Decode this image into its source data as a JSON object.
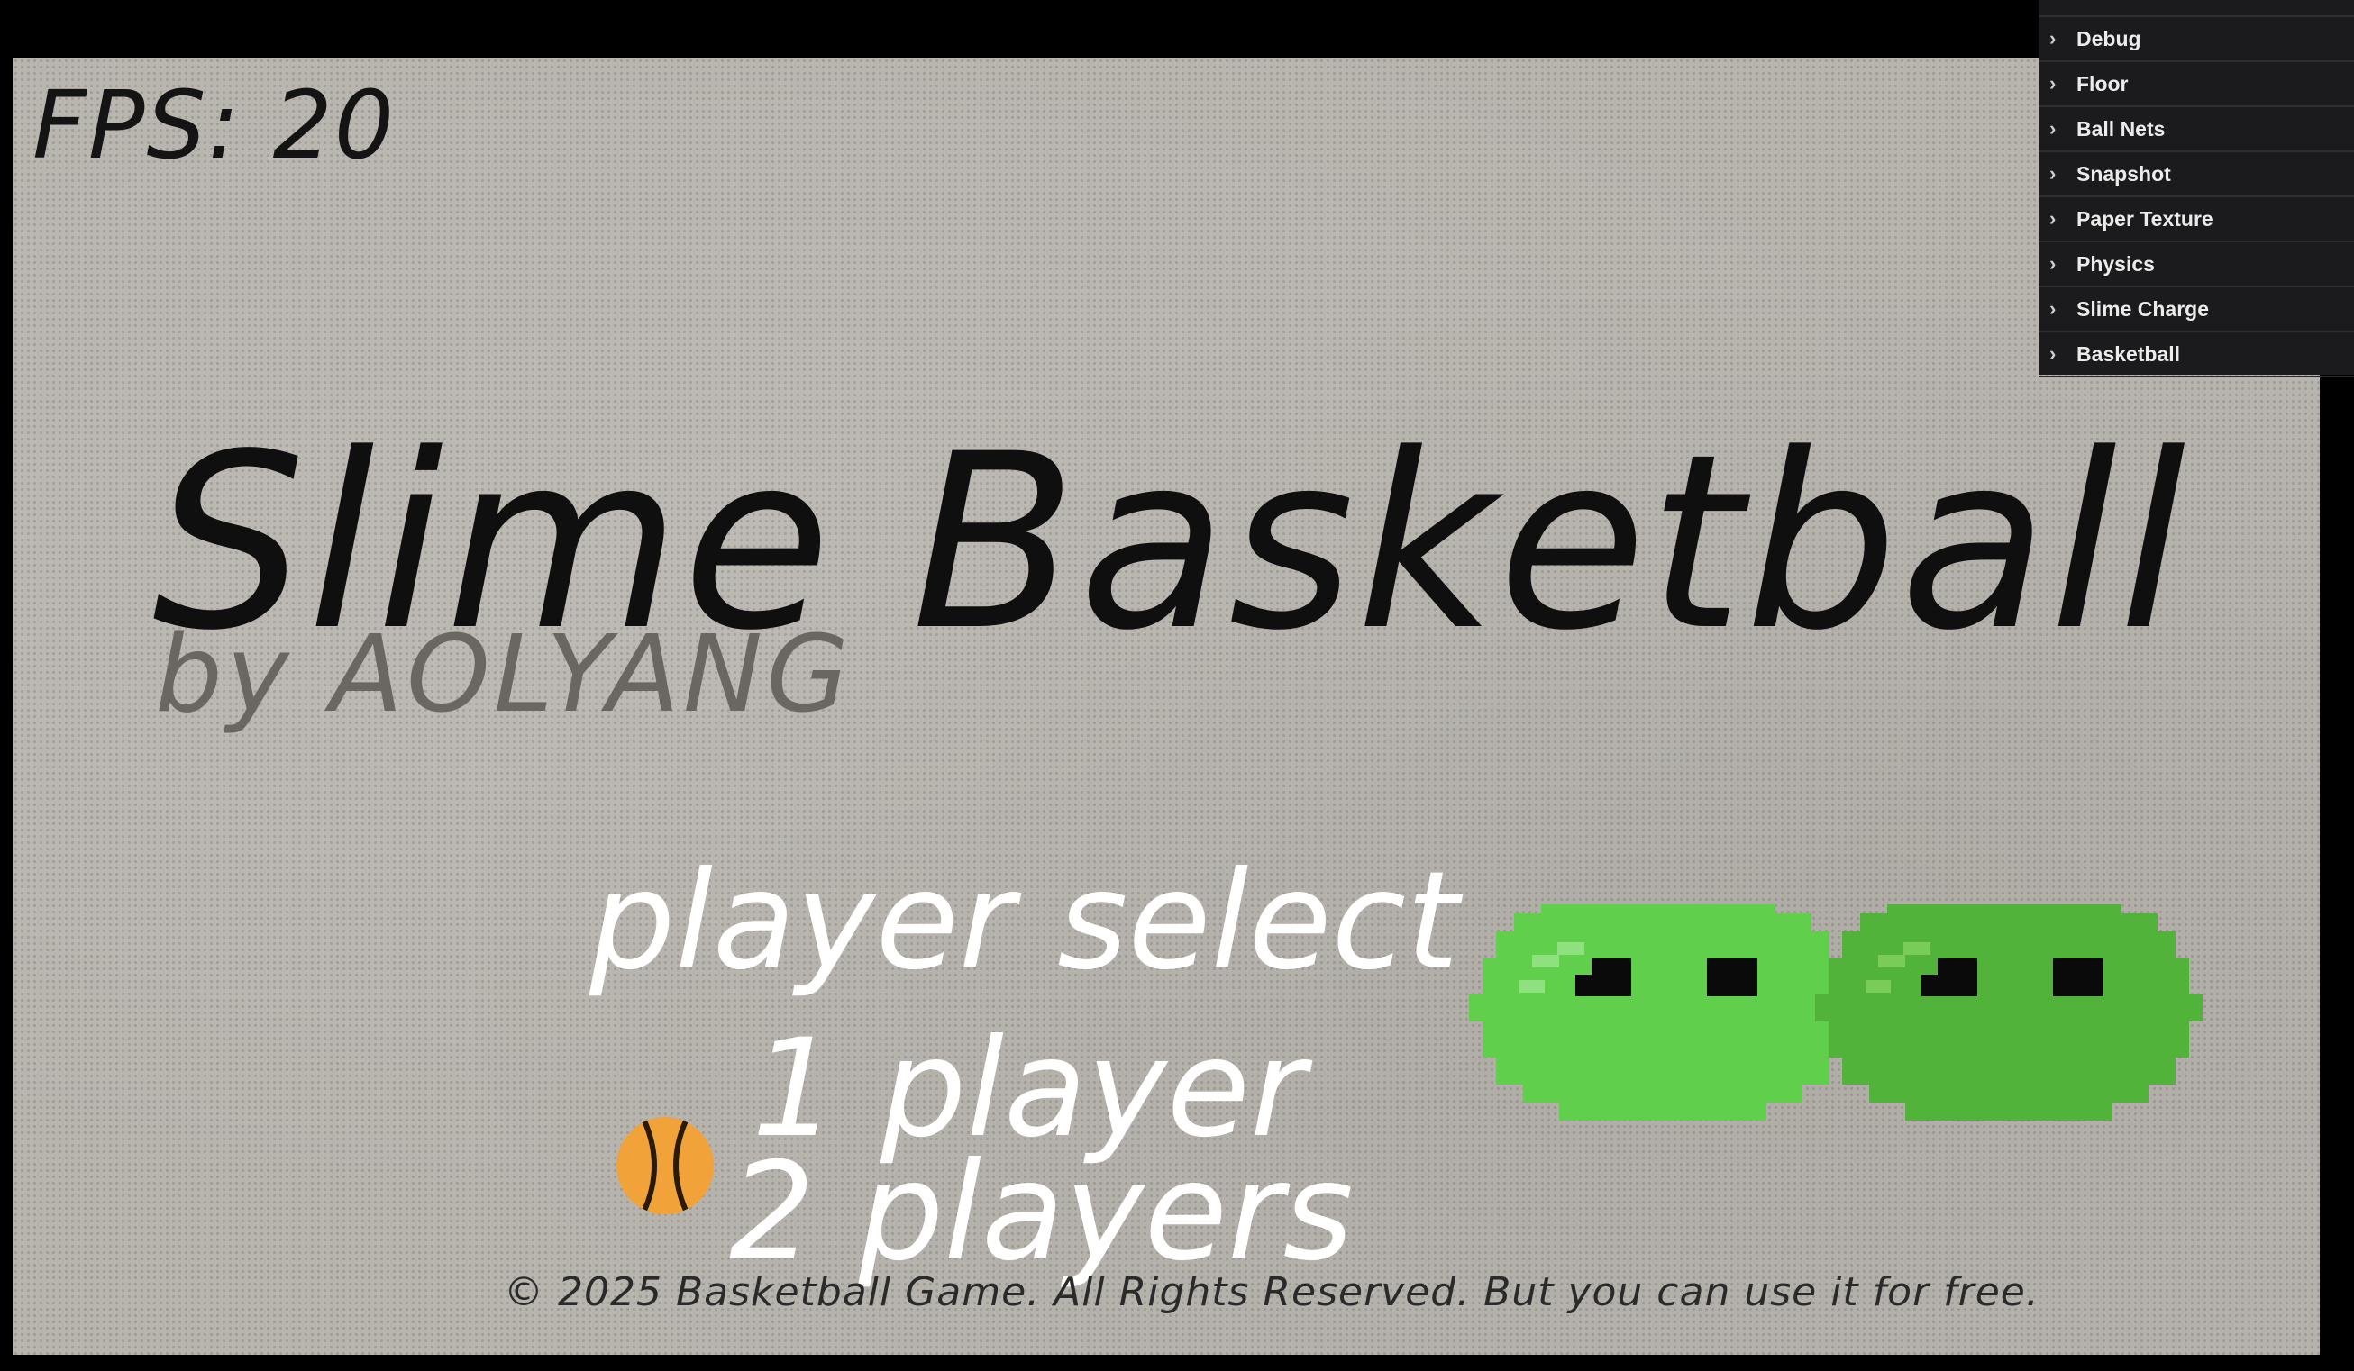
{
  "hud": {
    "fps_text": "FPS: 20"
  },
  "title": {
    "main": "Slime Basketball",
    "byline": "by AOLYANG"
  },
  "menu": {
    "heading": "player select",
    "items": [
      {
        "label": "1 player",
        "selected": false
      },
      {
        "label": "2 players",
        "selected": true
      }
    ],
    "cursor_icon": "basketball-icon"
  },
  "footer": {
    "text": "© 2025 Basketball Game. All Rights Reserved. But you can use it for free."
  },
  "slimes": [
    {
      "name": "left-slime",
      "color": "#5fcf4c"
    },
    {
      "name": "right-slime",
      "color": "#52b33a"
    }
  ],
  "debug_panel": {
    "folders": [
      {
        "label": "Debug",
        "icon": "chevron-right-icon"
      },
      {
        "label": "Floor",
        "icon": "chevron-right-icon"
      },
      {
        "label": "Ball Nets",
        "icon": "chevron-right-icon"
      },
      {
        "label": "Snapshot",
        "icon": "chevron-right-icon"
      },
      {
        "label": "Paper Texture",
        "icon": "chevron-right-icon"
      },
      {
        "label": "Physics",
        "icon": "chevron-right-icon"
      },
      {
        "label": "Slime Charge",
        "icon": "chevron-right-icon"
      },
      {
        "label": "Basketball",
        "icon": "chevron-right-icon"
      }
    ]
  },
  "colors": {
    "background": "#b8b4ae",
    "ball": "#f1a33a",
    "panel": "#1b1b1d"
  }
}
